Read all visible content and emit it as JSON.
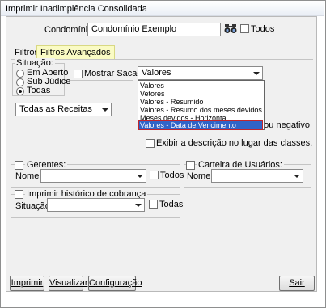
{
  "window": {
    "title": "Imprimir Inadimplência Consolidada"
  },
  "condominio": {
    "label": "Condomínio:",
    "value": "Condomínio Exemplo",
    "todos_label": "Todos"
  },
  "tabs": [
    {
      "label": "Filtros"
    },
    {
      "label": "Filtros Avançados"
    }
  ],
  "situacao": {
    "legend": "Situação:",
    "options": [
      "Em Aberto",
      "Sub Júdice",
      "Todas"
    ],
    "selected": "Todas"
  },
  "mostrar_sacado": {
    "label": "Mostrar Sacado"
  },
  "valores_combo": {
    "value": "Valores"
  },
  "valores_options": [
    "Valores",
    "Vetores",
    "Valores - Resumido",
    "Valores - Resumo dos meses devidos",
    "Meses devidos - Horizontal",
    "Valores - Data de Vencimento"
  ],
  "receitas_combo": {
    "value": "Todas as Receitas"
  },
  "negativo_text": "o ou negativo",
  "exibir_descricao": {
    "label": "Exibir a descrição no lugar das classes."
  },
  "gerentes": {
    "legend": "Gerentes:",
    "nome_label": "Nome:",
    "todos_label": "Todos"
  },
  "carteira": {
    "legend": "Carteira de Usuários:",
    "nome_label": "Nome:"
  },
  "historico": {
    "legend": "Imprimir histórico de cobrança",
    "situacao_label": "Situação:",
    "todas_label": "Todas"
  },
  "buttons": {
    "imprimir": "Imprimir",
    "visualizar": "Visualizar",
    "configuracao": "Configuração",
    "sair": "Sair"
  }
}
